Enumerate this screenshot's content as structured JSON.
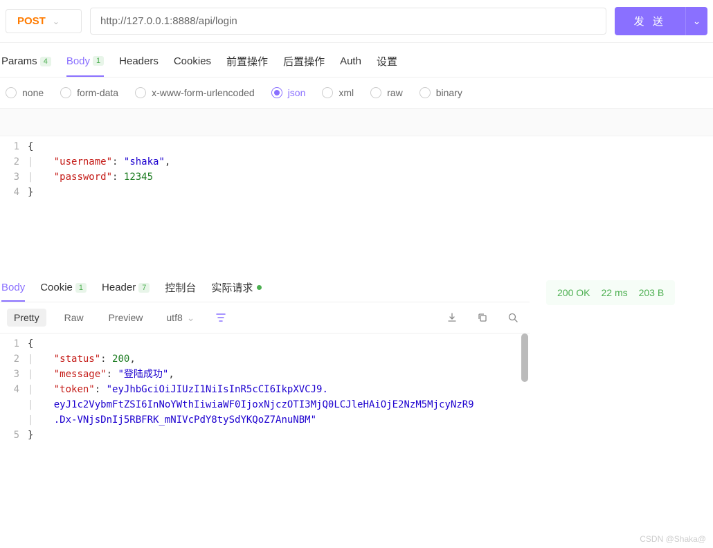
{
  "request": {
    "method": "POST",
    "url": "http://127.0.0.1:8888/api/login",
    "send_label": "发 送"
  },
  "tabs": {
    "params": {
      "label": "Params",
      "count": "4"
    },
    "body": {
      "label": "Body",
      "count": "1"
    },
    "headers": {
      "label": "Headers"
    },
    "cookies": {
      "label": "Cookies"
    },
    "pre": {
      "label": "前置操作"
    },
    "post": {
      "label": "后置操作"
    },
    "auth": {
      "label": "Auth"
    },
    "settings": {
      "label": "设置"
    }
  },
  "body_types": {
    "none": "none",
    "form": "form-data",
    "urlenc": "x-www-form-urlencoded",
    "json": "json",
    "xml": "xml",
    "raw": "raw",
    "binary": "binary"
  },
  "request_body": {
    "line1": "{",
    "line2_key": "\"username\"",
    "line2_val": "\"shaka\"",
    "line3_key": "\"password\"",
    "line3_val": "12345",
    "line4": "}"
  },
  "response_tabs": {
    "body": "Body",
    "cookie": {
      "label": "Cookie",
      "count": "1"
    },
    "header": {
      "label": "Header",
      "count": "7"
    },
    "console": "控制台",
    "actual": "实际请求"
  },
  "resp_toolbar": {
    "pretty": "Pretty",
    "raw": "Raw",
    "preview": "Preview",
    "encoding": "utf8"
  },
  "response_body": {
    "line1": "{",
    "l2_key": "\"status\"",
    "l2_val": "200",
    "l3_key": "\"message\"",
    "l3_val": "\"登陆成功\"",
    "l4_key": "\"token\"",
    "l4_val_a": "\"eyJhbGciOiJIUzI1NiIsInR5cCI6IkpXVCJ9.",
    "l4_val_b": "eyJ1c2VybmFtZSI6InNoYWthIiwiaWF0IjoxNjczOTI3MjQ0LCJleHAiOjE2NzM5MjcyNzR9",
    "l4_val_c": ".Dx-VNjsDnIj5RBFRK_mNIVcPdY8tySdYKQoZ7AnuNBM\"",
    "line5": "}"
  },
  "status": {
    "code": "200 OK",
    "time": "22 ms",
    "size": "203 B"
  },
  "watermark": "CSDN @Shaka@"
}
